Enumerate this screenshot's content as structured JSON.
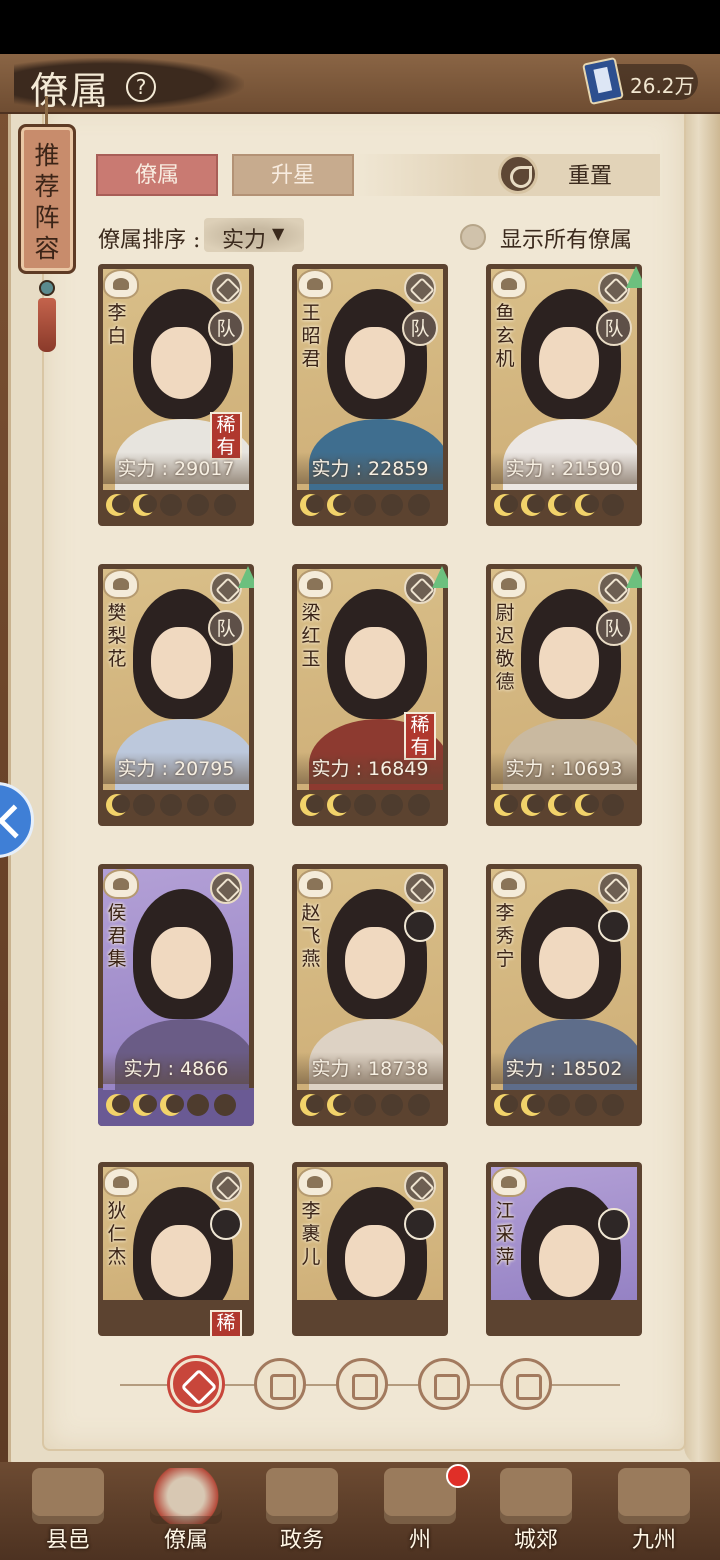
{
  "header": {
    "title": "僚属",
    "help_icon": "?",
    "currency_value": "26.2万"
  },
  "recommend": {
    "label": "推荐阵容"
  },
  "tabs": [
    {
      "label": "僚属",
      "active": true
    },
    {
      "label": "升星",
      "active": false
    }
  ],
  "reset": {
    "label": "重置"
  },
  "sort": {
    "label": "僚属排序 :",
    "value": "实力",
    "arrow": "▼"
  },
  "show_all": {
    "label": "显示所有僚属",
    "checked": false
  },
  "cards": [
    {
      "name": "李白",
      "power": "实力 : 29017",
      "rarity": "gold",
      "team": "队",
      "rare_tag": "稀有",
      "upgrade": false,
      "stars": 2
    },
    {
      "name": "王昭君",
      "power": "实力 : 22859",
      "rarity": "gold",
      "team": "队",
      "rare_tag": "",
      "upgrade": false,
      "stars": 2
    },
    {
      "name": "鱼玄机",
      "power": "实力 : 21590",
      "rarity": "gold",
      "team": "队",
      "rare_tag": "",
      "upgrade": true,
      "stars": 4
    },
    {
      "name": "樊梨花",
      "power": "实力 : 20795",
      "rarity": "gold",
      "team": "队",
      "rare_tag": "",
      "upgrade": true,
      "stars": 1
    },
    {
      "name": "梁红玉",
      "power": "实力 : 16849",
      "rarity": "gold",
      "team": "",
      "rare_tag": "稀有",
      "upgrade": true,
      "stars": 2
    },
    {
      "name": "尉迟敬德",
      "power": "实力 : 10693",
      "rarity": "gold",
      "team": "队",
      "rare_tag": "",
      "upgrade": true,
      "stars": 4
    },
    {
      "name": "侯君集",
      "power": "实力 : 4866",
      "rarity": "purple",
      "team": "",
      "rare_tag": "",
      "upgrade": false,
      "stars": 3
    },
    {
      "name": "赵飞燕",
      "power": "实力 : 18738",
      "rarity": "gold",
      "team": "",
      "rare_tag": "",
      "upgrade": false,
      "stars": 2
    },
    {
      "name": "李秀宁",
      "power": "实力 : 18502",
      "rarity": "gold",
      "team": "",
      "rare_tag": "",
      "upgrade": false,
      "stars": 2
    },
    {
      "name": "狄仁杰",
      "power": "",
      "rarity": "gold",
      "team": "",
      "rare_tag": "稀",
      "upgrade": false,
      "stars": 0
    },
    {
      "name": "李裹儿",
      "power": "",
      "rarity": "gold",
      "team": "",
      "rare_tag": "",
      "upgrade": false,
      "stars": 0
    },
    {
      "name": "江采萍",
      "power": "",
      "rarity": "purple",
      "team": "",
      "rare_tag": "",
      "upgrade": false,
      "stars": 0
    }
  ],
  "filters": [
    {
      "icon": "all-filter-icon",
      "active": true
    },
    {
      "icon": "scholar-filter-icon",
      "active": false
    },
    {
      "icon": "mouse-filter-icon",
      "active": false
    },
    {
      "icon": "fan-filter-icon",
      "active": false
    },
    {
      "icon": "monkey-filter-icon",
      "active": false
    }
  ],
  "nav": [
    {
      "label": "县邑",
      "active": false
    },
    {
      "label": "僚属",
      "active": true
    },
    {
      "label": "政务",
      "active": false
    },
    {
      "label": "州",
      "active": false
    },
    {
      "label": "城郊",
      "active": false
    },
    {
      "label": "九州",
      "active": false
    }
  ],
  "colors": {
    "tab_active": "#c97a72",
    "card_gold": "#d9bf89",
    "card_purple": "#b3a0d6",
    "badge_red": "#e02f28",
    "upgrade_green": "#6cc07e"
  }
}
